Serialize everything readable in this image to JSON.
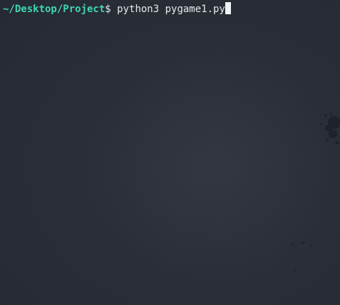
{
  "terminal": {
    "prompt_path": "~/Desktop/Project",
    "prompt_symbol": "$ ",
    "command": "python3 pygame1.py"
  },
  "colors": {
    "background": "#282c34",
    "prompt_path": "#3fd6b4",
    "text": "#e6e8ec",
    "cursor": "#f2f2f2"
  }
}
